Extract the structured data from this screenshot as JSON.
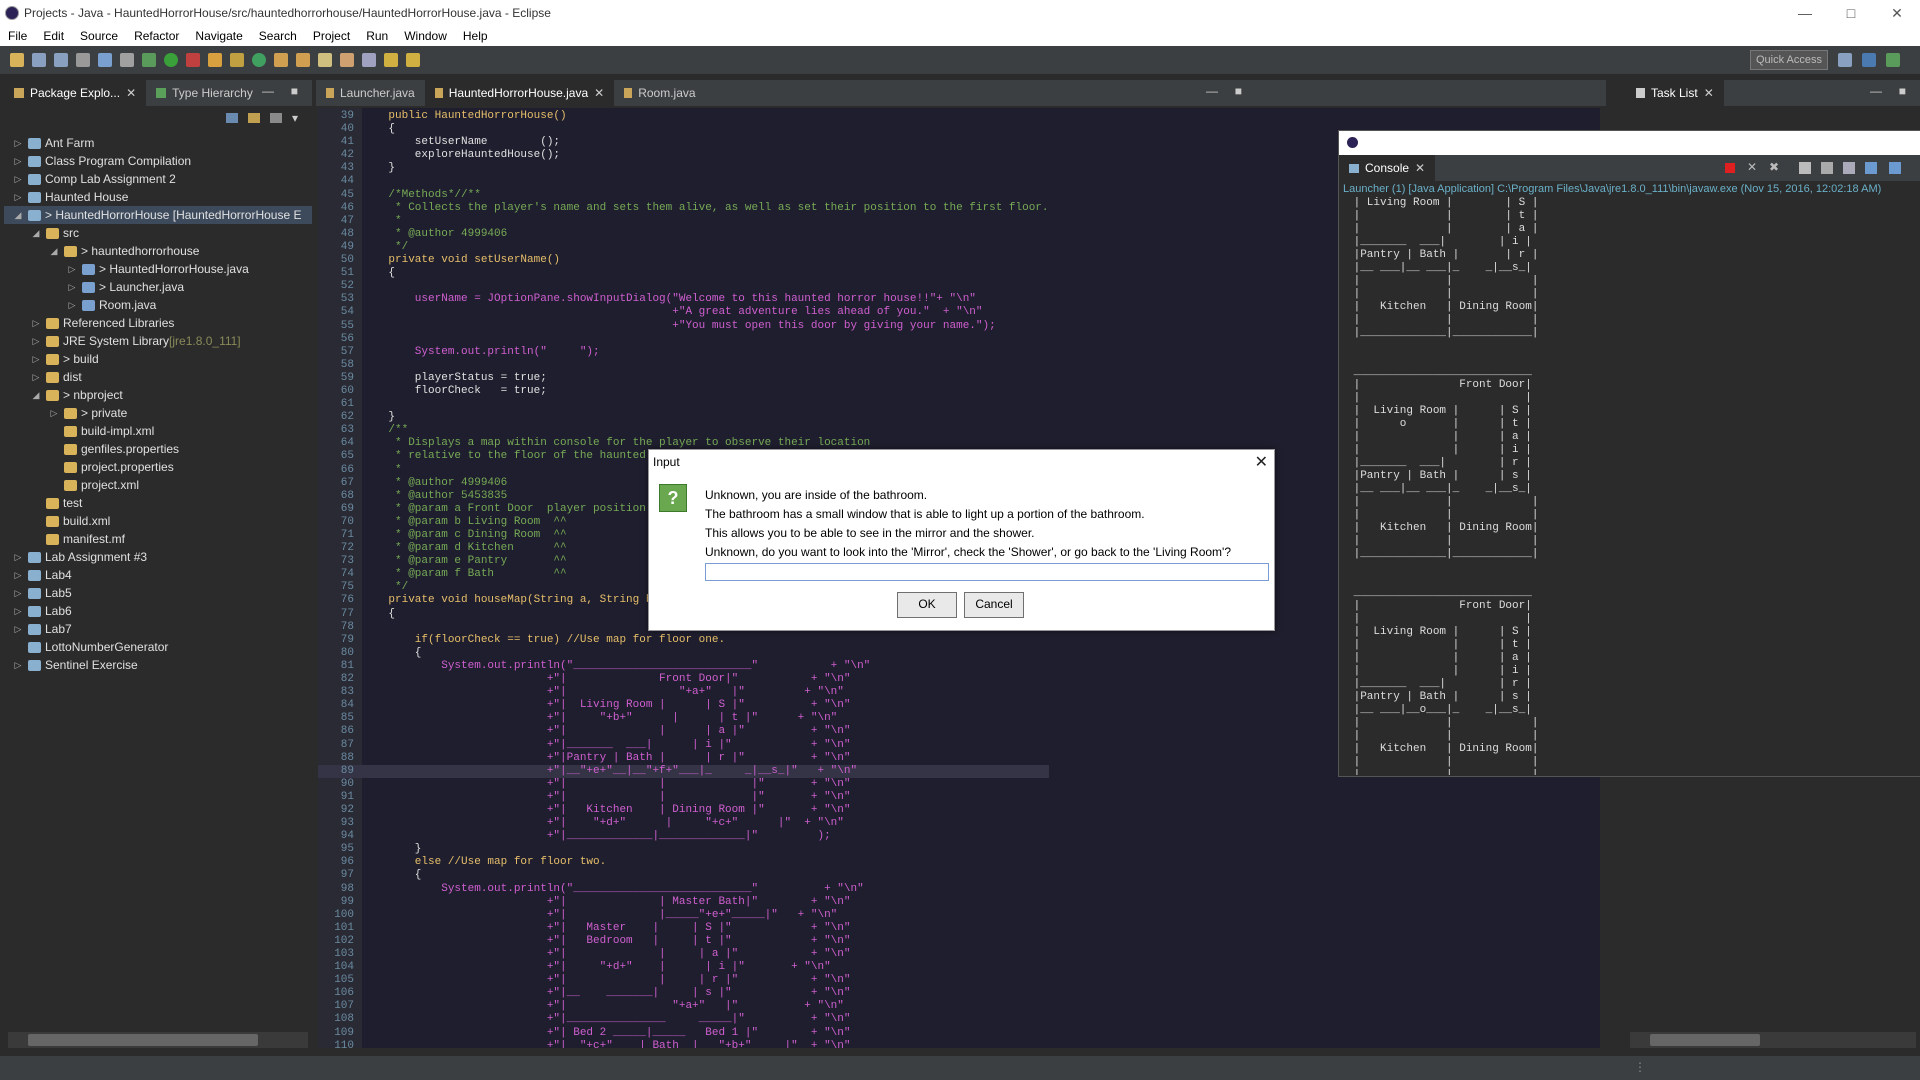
{
  "window": {
    "title": "Projects - Java - HauntedHorrorHouse/src/hauntedhorrorhouse/HauntedHorrorHouse.java - Eclipse"
  },
  "menu": [
    "File",
    "Edit",
    "Source",
    "Refactor",
    "Navigate",
    "Search",
    "Project",
    "Run",
    "Window",
    "Help"
  ],
  "toolbar": {
    "quick_access": "Quick Access"
  },
  "package_explorer": {
    "tabs": [
      "Package Explo...",
      "Type Hierarchy"
    ],
    "items": [
      {
        "indent": 0,
        "arrow": "▷",
        "label": "Ant Farm",
        "hint": ""
      },
      {
        "indent": 0,
        "arrow": "▷",
        "label": "Class Program Compilation",
        "hint": ""
      },
      {
        "indent": 0,
        "arrow": "▷",
        "label": "Comp Lab Assignment 2",
        "hint": ""
      },
      {
        "indent": 0,
        "arrow": "▷",
        "label": "Haunted House",
        "hint": ""
      },
      {
        "indent": 0,
        "arrow": "◢",
        "label": "> HauntedHorrorHouse [HauntedHorrorHouse E",
        "hint": ""
      },
      {
        "indent": 1,
        "arrow": "◢",
        "label": "src",
        "hint": ""
      },
      {
        "indent": 2,
        "arrow": "◢",
        "label": "> hauntedhorrorhouse",
        "hint": ""
      },
      {
        "indent": 3,
        "arrow": "▷",
        "label": "> HauntedHorrorHouse.java",
        "hint": ""
      },
      {
        "indent": 3,
        "arrow": "▷",
        "label": "> Launcher.java",
        "hint": ""
      },
      {
        "indent": 3,
        "arrow": "▷",
        "label": "Room.java",
        "hint": ""
      },
      {
        "indent": 1,
        "arrow": "▷",
        "label": "Referenced Libraries",
        "hint": ""
      },
      {
        "indent": 1,
        "arrow": "▷",
        "label": "JRE System Library ",
        "hint": "[jre1.8.0_111]"
      },
      {
        "indent": 1,
        "arrow": "▷",
        "label": "> build",
        "hint": ""
      },
      {
        "indent": 1,
        "arrow": "▷",
        "label": "dist",
        "hint": ""
      },
      {
        "indent": 1,
        "arrow": "◢",
        "label": "> nbproject",
        "hint": ""
      },
      {
        "indent": 2,
        "arrow": "▷",
        "label": "> private",
        "hint": ""
      },
      {
        "indent": 2,
        "arrow": "",
        "label": "build-impl.xml",
        "hint": ""
      },
      {
        "indent": 2,
        "arrow": "",
        "label": "genfiles.properties",
        "hint": ""
      },
      {
        "indent": 2,
        "arrow": "",
        "label": "project.properties",
        "hint": ""
      },
      {
        "indent": 2,
        "arrow": "",
        "label": "project.xml",
        "hint": ""
      },
      {
        "indent": 1,
        "arrow": "",
        "label": "test",
        "hint": ""
      },
      {
        "indent": 1,
        "arrow": "",
        "label": "build.xml",
        "hint": ""
      },
      {
        "indent": 1,
        "arrow": "",
        "label": "manifest.mf",
        "hint": ""
      },
      {
        "indent": 0,
        "arrow": "▷",
        "label": "Lab Assignment #3",
        "hint": ""
      },
      {
        "indent": 0,
        "arrow": "▷",
        "label": "Lab4",
        "hint": ""
      },
      {
        "indent": 0,
        "arrow": "▷",
        "label": "Lab5",
        "hint": ""
      },
      {
        "indent": 0,
        "arrow": "▷",
        "label": "Lab6",
        "hint": ""
      },
      {
        "indent": 0,
        "arrow": "▷",
        "label": "Lab7",
        "hint": ""
      },
      {
        "indent": 0,
        "arrow": "",
        "label": "LottoNumberGenerator",
        "hint": ""
      },
      {
        "indent": 0,
        "arrow": "▷",
        "label": "Sentinel Exercise",
        "hint": ""
      }
    ]
  },
  "editor": {
    "tabs": [
      "Launcher.java",
      "HauntedHorrorHouse.java",
      "Room.java"
    ],
    "lines": [
      {
        "n": "39",
        "t": "    public HauntedHorrorHouse()"
      },
      {
        "n": "40",
        "t": "    {"
      },
      {
        "n": "41",
        "t": "        setUserName        ();"
      },
      {
        "n": "42",
        "t": "        exploreHauntedHouse();"
      },
      {
        "n": "43",
        "t": "    }"
      },
      {
        "n": "44",
        "t": ""
      },
      {
        "n": "45",
        "t": "    /*Methods*//**"
      },
      {
        "n": "46",
        "t": "     * Collects the player's name and sets them alive, as well as set their position to the first floor."
      },
      {
        "n": "47",
        "t": "     *"
      },
      {
        "n": "48",
        "t": "     * @author 4999406"
      },
      {
        "n": "49",
        "t": "     */"
      },
      {
        "n": "50",
        "t": "    private void setUserName()"
      },
      {
        "n": "51",
        "t": "    {"
      },
      {
        "n": "52",
        "t": ""
      },
      {
        "n": "53",
        "t": "        userName = JOptionPane.showInputDialog(\"Welcome to this haunted horror house!!\"+ \"\\n\""
      },
      {
        "n": "54",
        "t": "                                               +\"A great adventure lies ahead of you.\"  + \"\\n\""
      },
      {
        "n": "55",
        "t": "                                               +\"You must open this door by giving your name.\");"
      },
      {
        "n": "56",
        "t": ""
      },
      {
        "n": "57",
        "t": "        System.out.println(\"     \");"
      },
      {
        "n": "58",
        "t": ""
      },
      {
        "n": "59",
        "t": "        playerStatus = true;"
      },
      {
        "n": "60",
        "t": "        floorCheck   = true;"
      },
      {
        "n": "61",
        "t": ""
      },
      {
        "n": "62",
        "t": "    }"
      },
      {
        "n": "63",
        "t": "    /**"
      },
      {
        "n": "64",
        "t": "     * Displays a map within console for the player to observe their location"
      },
      {
        "n": "65",
        "t": "     * relative to the floor of the haunted hous"
      },
      {
        "n": "66",
        "t": "     *"
      },
      {
        "n": "67",
        "t": "     * @author 4999406"
      },
      {
        "n": "68",
        "t": "     * @author 5453835"
      },
      {
        "n": "69",
        "t": "     * @param a Front Door  player position mark"
      },
      {
        "n": "70",
        "t": "     * @param b Living Room  ^^"
      },
      {
        "n": "71",
        "t": "     * @param c Dining Room  ^^"
      },
      {
        "n": "72",
        "t": "     * @param d Kitchen      ^^"
      },
      {
        "n": "73",
        "t": "     * @param e Pantry       ^^"
      },
      {
        "n": "74",
        "t": "     * @param f Bath         ^^"
      },
      {
        "n": "75",
        "t": "     */"
      },
      {
        "n": "76",
        "t": "    private void houseMap(String a, String b,  S"
      },
      {
        "n": "77",
        "t": "    {"
      },
      {
        "n": "78",
        "t": ""
      },
      {
        "n": "79",
        "t": "        if(floorCheck == true) //Use map for floor one."
      },
      {
        "n": "80",
        "t": "        {"
      },
      {
        "n": "81",
        "t": "            System.out.println(\"___________________________\"           + \"\\n\""
      },
      {
        "n": "82",
        "t": "                            +\"|              Front Door|\"           + \"\\n\""
      },
      {
        "n": "83",
        "t": "                            +\"|                 \"+a+\"   |\"         + \"\\n\""
      },
      {
        "n": "84",
        "t": "                            +\"|  Living Room |      | S |\"          + \"\\n\""
      },
      {
        "n": "85",
        "t": "                            +\"|     \"+b+\"      |      | t |\"      + \"\\n\""
      },
      {
        "n": "86",
        "t": "                            +\"|              |      | a |\"          + \"\\n\""
      },
      {
        "n": "87",
        "t": "                            +\"|_______  ___|      | i |\"            + \"\\n\""
      },
      {
        "n": "88",
        "t": "                            +\"|Pantry | Bath |      | r |\"          + \"\\n\""
      },
      {
        "n": "89",
        "t": "                            +\"|__\"+e+\"__|__\"+f+\"___|_     _|__s_|\"   + \"\\n\""
      },
      {
        "n": "90",
        "t": "                            +\"|              |             |\"       + \"\\n\""
      },
      {
        "n": "91",
        "t": "                            +\"|              |             |\"       + \"\\n\""
      },
      {
        "n": "92",
        "t": "                            +\"|   Kitchen    | Dining Room |\"       + \"\\n\""
      },
      {
        "n": "93",
        "t": "                            +\"|    \"+d+\"      |     \"+c+\"      |\"  + \"\\n\""
      },
      {
        "n": "94",
        "t": "                            +\"|_____________|_____________|\"         );"
      },
      {
        "n": "95",
        "t": "        }"
      },
      {
        "n": "96",
        "t": "        else //Use map for floor two."
      },
      {
        "n": "97",
        "t": "        {"
      },
      {
        "n": "98",
        "t": "            System.out.println(\"___________________________\"          + \"\\n\""
      },
      {
        "n": "99",
        "t": "                            +\"|              | Master Bath|\"        + \"\\n\""
      },
      {
        "n": "100",
        "t": "                            +\"|              |_____\"+e+\"_____|\"   + \"\\n\""
      },
      {
        "n": "101",
        "t": "                            +\"|   Master    |     | S |\"            + \"\\n\""
      },
      {
        "n": "102",
        "t": "                            +\"|   Bedroom   |     | t |\"            + \"\\n\""
      },
      {
        "n": "103",
        "t": "                            +\"|              |     | a |\"           + \"\\n\""
      },
      {
        "n": "104",
        "t": "                            +\"|     \"+d+\"    |      | i |\"       + \"\\n\""
      },
      {
        "n": "105",
        "t": "                            +\"|              |     | r |\"           + \"\\n\""
      },
      {
        "n": "106",
        "t": "                            +\"|__    _______|     | s |\"            + \"\\n\""
      },
      {
        "n": "107",
        "t": "                            +\"|                \"+a+\"   |\"          + \"\\n\""
      },
      {
        "n": "108",
        "t": "                            +\"|_______________     _____|\"          + \"\\n\""
      },
      {
        "n": "109",
        "t": "                            +\"| Bed 2 _____|_____   Bed 1 |\"        + \"\\n\""
      },
      {
        "n": "110",
        "t": "                            +\"|  \"+c+\"    | Bath  |   \"+b+\"     |\"  + \"\\n\""
      }
    ]
  },
  "console": {
    "tab": "Console",
    "header": "Launcher (1) [Java Application] C:\\Program Files\\Java\\jre1.8.0_111\\bin\\javaw.exe (Nov 15, 2016, 12:02:18 AM)",
    "output": " | Living Room |        | S |\n |             |        | t |\n |             |        | a |\n |_______  ___|        | i |\n |Pantry | Bath |       | r |\n |__ ___|__ ___|_    _|__s_|\n |             |            |\n |             |            |\n |   Kitchen   | Dining Room|\n |             |            |\n |_____________|____________|\n\n\n ___________________________\n |               Front Door|\n |                         |\n |  Living Room |      | S |\n |      o       |      | t |\n |              |      | a |\n |              |      | i |\n |_______  ___|        | r |\n |Pantry | Bath |      | s |\n |__ ___|__ ___|_    _|__s_|\n |             |            |\n |             |            |\n |   Kitchen   | Dining Room|\n |             |            |\n |_____________|____________|\n\n\n ___________________________\n |               Front Door|\n |                         |\n |  Living Room |      | S |\n |              |      | t |\n |              |      | a |\n |              |      | i |\n |_______  ___|        | r |\n |Pantry | Bath |      | s |\n |__ ___|__o___|_    _|__s_|\n |             |            |\n |             |            |\n |   Kitchen   | Dining Room|\n |             |            |\n |_____________|____________|"
  },
  "task_list": {
    "tab": "Task List"
  },
  "dialog": {
    "title": "Input",
    "lines": [
      "Unknown, you are inside of the bathroom.",
      "The bathroom has a small window that is able to light up a portion of the bathroom.",
      "This allows you to be able to see in the mirror and the shower.",
      "Unknown, do you want to look into the 'Mirror', check the 'Shower', or go back to the 'Living Room'?"
    ],
    "input_value": "",
    "ok": "OK",
    "cancel": "Cancel"
  },
  "colors": {
    "keyword": "#cc7832",
    "comment": "#77aa55",
    "string": "#d05fd0",
    "accent": "#6aa84f"
  }
}
